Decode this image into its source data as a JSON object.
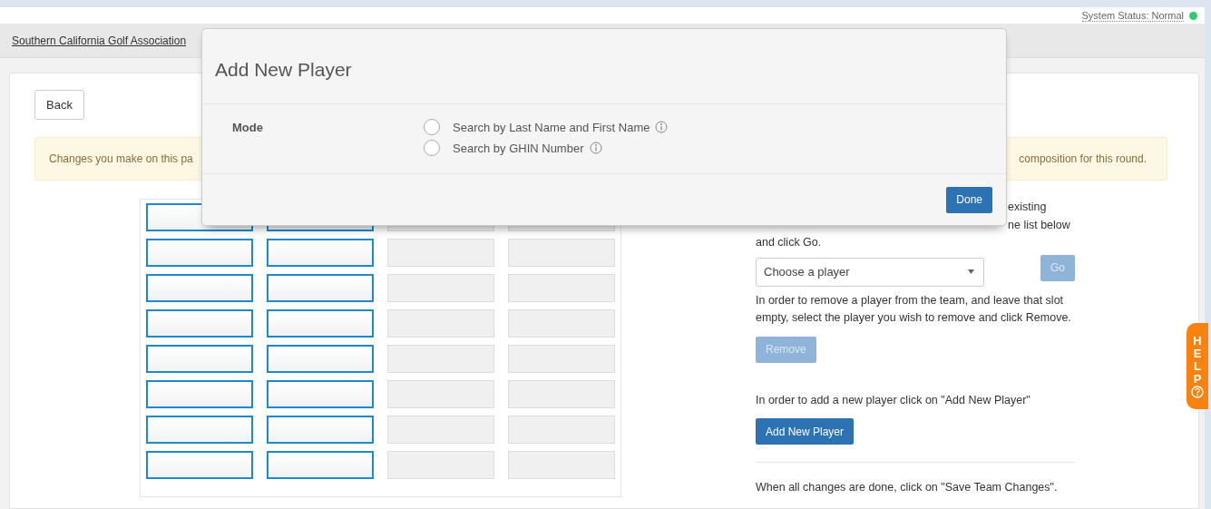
{
  "status": {
    "label": "System Status: Normal",
    "color": "#2ecc71"
  },
  "nav": {
    "link": "Southern California Golf Association"
  },
  "back_button": "Back",
  "alert": {
    "left": "Changes you make on this pa",
    "right": "composition for this round."
  },
  "slots": [
    {
      "cells": [
        {
          "disabled": false
        },
        {
          "disabled": false
        },
        {
          "disabled": true
        },
        {
          "disabled": true
        }
      ]
    },
    {
      "cells": [
        {
          "disabled": false
        },
        {
          "disabled": false
        },
        {
          "disabled": true
        },
        {
          "disabled": true
        }
      ]
    },
    {
      "cells": [
        {
          "disabled": false
        },
        {
          "disabled": false
        },
        {
          "disabled": true
        },
        {
          "disabled": true
        }
      ]
    },
    {
      "cells": [
        {
          "disabled": false
        },
        {
          "disabled": false
        },
        {
          "disabled": true
        },
        {
          "disabled": true
        }
      ]
    },
    {
      "cells": [
        {
          "disabled": false
        },
        {
          "disabled": false
        },
        {
          "disabled": true
        },
        {
          "disabled": true
        }
      ]
    },
    {
      "cells": [
        {
          "disabled": false
        },
        {
          "disabled": false
        },
        {
          "disabled": true
        },
        {
          "disabled": true
        }
      ]
    },
    {
      "cells": [
        {
          "disabled": false
        },
        {
          "disabled": false
        },
        {
          "disabled": true
        },
        {
          "disabled": true
        }
      ]
    },
    {
      "cells": [
        {
          "disabled": false
        },
        {
          "disabled": false
        },
        {
          "disabled": true
        },
        {
          "disabled": true
        }
      ]
    }
  ],
  "instructions": {
    "swap_lines": [
      "existing",
      "ne list below",
      "and click Go."
    ],
    "select": {
      "placeholder": "Choose a player"
    },
    "go_button": {
      "label": "Go",
      "disabled": true
    },
    "remove_text": "In order to remove a player from the team, and leave that slot empty, select the player you wish to remove and click Remove.",
    "remove_button": {
      "label": "Remove",
      "disabled": true
    },
    "add_text": "In order to add a new player click on \"Add New Player\"",
    "add_button": {
      "label": "Add New Player",
      "disabled": false
    },
    "save_text": "When all changes are done, click on \"Save Team Changes\"."
  },
  "help_tab": {
    "letters": [
      "H",
      "E",
      "L",
      "P"
    ]
  },
  "modal": {
    "title": "Add New Player",
    "mode_label": "Mode",
    "options": [
      {
        "label": "Search by Last Name and First Name",
        "selected": false
      },
      {
        "label": "Search by GHIN Number",
        "selected": false
      }
    ],
    "done_button": "Done"
  }
}
